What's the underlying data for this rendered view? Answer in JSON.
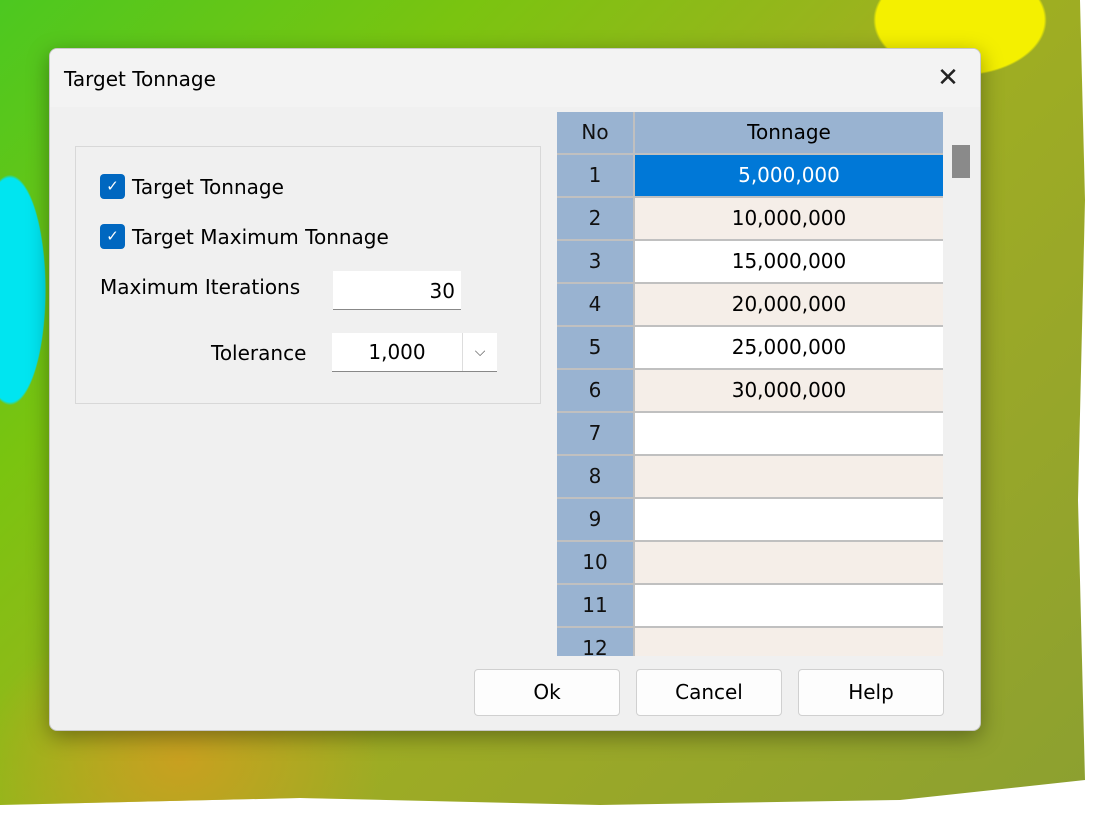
{
  "dialog": {
    "title": "Target Tonnage",
    "close_icon": "close-icon"
  },
  "options": {
    "target_tonnage": {
      "label": "Target Tonnage",
      "checked": true
    },
    "target_max_tonnage": {
      "label": "Target Maximum Tonnage",
      "checked": true
    },
    "max_iterations": {
      "label": "Maximum Iterations",
      "value": "30"
    },
    "tolerance": {
      "label": "Tolerance",
      "value": "1,000"
    }
  },
  "table": {
    "headers": [
      "No",
      "Tonnage"
    ],
    "rows": [
      [
        "1",
        "5,000,000"
      ],
      [
        "2",
        "10,000,000"
      ],
      [
        "3",
        "15,000,000"
      ],
      [
        "4",
        "20,000,000"
      ],
      [
        "5",
        "25,000,000"
      ],
      [
        "6",
        "30,000,000"
      ],
      [
        "7",
        ""
      ],
      [
        "8",
        ""
      ],
      [
        "9",
        ""
      ],
      [
        "10",
        ""
      ],
      [
        "11",
        ""
      ],
      [
        "12",
        ""
      ]
    ],
    "selected_row": 1,
    "selection_color": "#0078d7"
  },
  "buttons": {
    "ok": "Ok",
    "cancel": "Cancel",
    "help": "Help"
  }
}
